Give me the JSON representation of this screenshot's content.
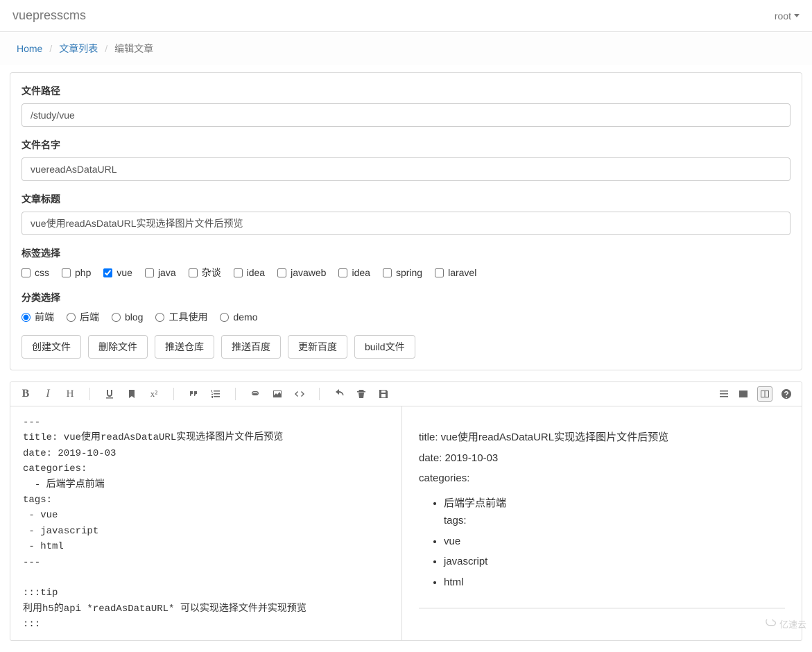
{
  "navbar": {
    "brand": "vuepresscms",
    "user": "root"
  },
  "breadcrumb": {
    "home": "Home",
    "list": "文章列表",
    "current": "编辑文章"
  },
  "form": {
    "path_label": "文件路径",
    "path_value": "/study/vue",
    "name_label": "文件名字",
    "name_value": "vuereadAsDataURL",
    "title_label": "文章标题",
    "title_value": "vue使用readAsDataURL实现选择图片文件后预览",
    "tags_label": "标签选择",
    "tags": [
      {
        "label": "css",
        "checked": false
      },
      {
        "label": "php",
        "checked": false
      },
      {
        "label": "vue",
        "checked": true
      },
      {
        "label": "java",
        "checked": false
      },
      {
        "label": "杂谈",
        "checked": false
      },
      {
        "label": "idea",
        "checked": false
      },
      {
        "label": "javaweb",
        "checked": false
      },
      {
        "label": "idea",
        "checked": false
      },
      {
        "label": "spring",
        "checked": false
      },
      {
        "label": "laravel",
        "checked": false
      }
    ],
    "category_label": "分类选择",
    "categories": [
      {
        "label": "前端",
        "checked": true
      },
      {
        "label": "后端",
        "checked": false
      },
      {
        "label": "blog",
        "checked": false
      },
      {
        "label": "工具使用",
        "checked": false
      },
      {
        "label": "demo",
        "checked": false
      }
    ],
    "buttons": {
      "create": "创建文件",
      "delete": "删除文件",
      "push_repo": "推送仓库",
      "push_baidu": "推送百度",
      "update_baidu": "更新百度",
      "build": "build文件"
    }
  },
  "editor": {
    "source": "---\ntitle: vue使用readAsDataURL实现选择图片文件后预览\ndate: 2019-10-03\ncategories:\n  - 后端学点前端\ntags:\n - vue\n - javascript\n - html\n---\n\n:::tip\n利用h5的api *readAsDataURL* 可以实现选择文件并实现预览\n:::",
    "preview": {
      "title_line": "title: vue使用readAsDataURL实现选择图片文件后预览",
      "date_line": "date: 2019-10-03",
      "categories_line": "categories:",
      "list": [
        "后端学点前端",
        "vue",
        "javascript",
        "html"
      ],
      "tags_inline": "tags:"
    }
  },
  "watermark": "亿速云"
}
